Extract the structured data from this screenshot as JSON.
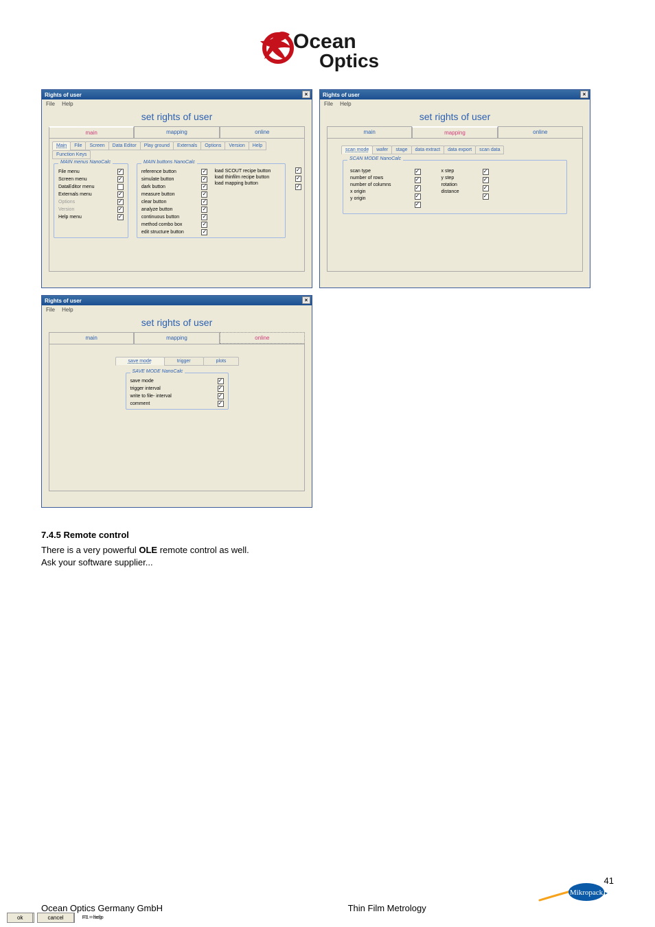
{
  "logo_text1": "Ocean",
  "logo_text2": "Optics",
  "dialog_common": {
    "title": "Rights of user",
    "menu_file": "File",
    "menu_help": "Help",
    "heading": "set rights of user",
    "top_tabs": [
      "main",
      "mapping",
      "online"
    ],
    "ok": "ok",
    "cancel": "cancel",
    "f1": "F1 = help"
  },
  "dlg1": {
    "inner_tabs": [
      "Main",
      "File",
      "Screen",
      "Data  Editor",
      "Play ground",
      "Externals",
      "Options",
      "Version",
      "Help",
      "Function  Keys"
    ],
    "group1_title": "MAIN menus NanoCalc",
    "group1_items": [
      {
        "label": "File menu",
        "checked": true,
        "disabled": false
      },
      {
        "label": "Screen menu",
        "checked": true,
        "disabled": false
      },
      {
        "label": "DataEditor menu",
        "checked": false,
        "disabled": false
      },
      {
        "label": "Externals menu",
        "checked": true,
        "disabled": false
      },
      {
        "label": "Options",
        "checked": true,
        "disabled": true
      },
      {
        "label": "Version",
        "checked": true,
        "disabled": true
      },
      {
        "label": "Help menu",
        "checked": true,
        "disabled": false
      }
    ],
    "group2_title": "MAIN buttons NanoCalc",
    "group2_items": [
      {
        "label": "reference button",
        "checked": true
      },
      {
        "label": "simulate button",
        "checked": true
      },
      {
        "label": "dark button",
        "checked": true
      },
      {
        "label": "measure button",
        "checked": true
      },
      {
        "label": "clear button",
        "checked": true
      },
      {
        "label": "analyze button",
        "checked": true
      },
      {
        "label": "continuous button",
        "checked": true
      },
      {
        "label": "method combo box",
        "checked": true
      },
      {
        "label": "edit structure button",
        "checked": true
      }
    ],
    "group2_right": [
      {
        "label": "load SCOUT recipe button",
        "checked": true
      },
      {
        "label": "load thinfilm recipe button",
        "checked": true
      },
      {
        "label": "load mapping button",
        "checked": true
      }
    ],
    "right_checks": [
      true,
      true,
      true
    ]
  },
  "dlg2": {
    "inner_tabs": [
      "scan mode",
      "wafer",
      "stage",
      "data extract",
      "data export",
      "scan data"
    ],
    "group_title": "SCAN MODE NanoCalc",
    "left": [
      {
        "label": "scan type",
        "checked": true
      },
      {
        "label": "number of rows",
        "checked": true
      },
      {
        "label": "number of columns",
        "checked": true
      },
      {
        "label": "x origin",
        "checked": true
      },
      {
        "label": "y origin",
        "checked": true
      }
    ],
    "right": [
      {
        "label": "x step",
        "checked": true
      },
      {
        "label": "y step",
        "checked": true
      },
      {
        "label": "rotation",
        "checked": true
      },
      {
        "label": "distance",
        "checked": true
      }
    ],
    "ok": "Ok",
    "cancel": "cancel"
  },
  "dlg3": {
    "inner_tabs": [
      "save mode",
      "trigger",
      "plots"
    ],
    "group_title": "SAVE MODE NanoCalc",
    "items": [
      {
        "label": "save mode",
        "checked": true
      },
      {
        "label": "trigger interval",
        "checked": true
      },
      {
        "label": "write to file- interval",
        "checked": true
      },
      {
        "label": "comment",
        "checked": true
      }
    ]
  },
  "section_heading": "7.4.5     Remote control",
  "body_text_prefix": "There is a very powerful ",
  "body_text_bold": "OLE",
  "body_text_suffix": " remote control as well.",
  "body_text_line2": "Ask your software supplier...",
  "page_number": "41",
  "footer_left": "Ocean Optics Germany GmbH",
  "footer_right": "Thin Film Metrology",
  "mikro_label": "Mikropack"
}
